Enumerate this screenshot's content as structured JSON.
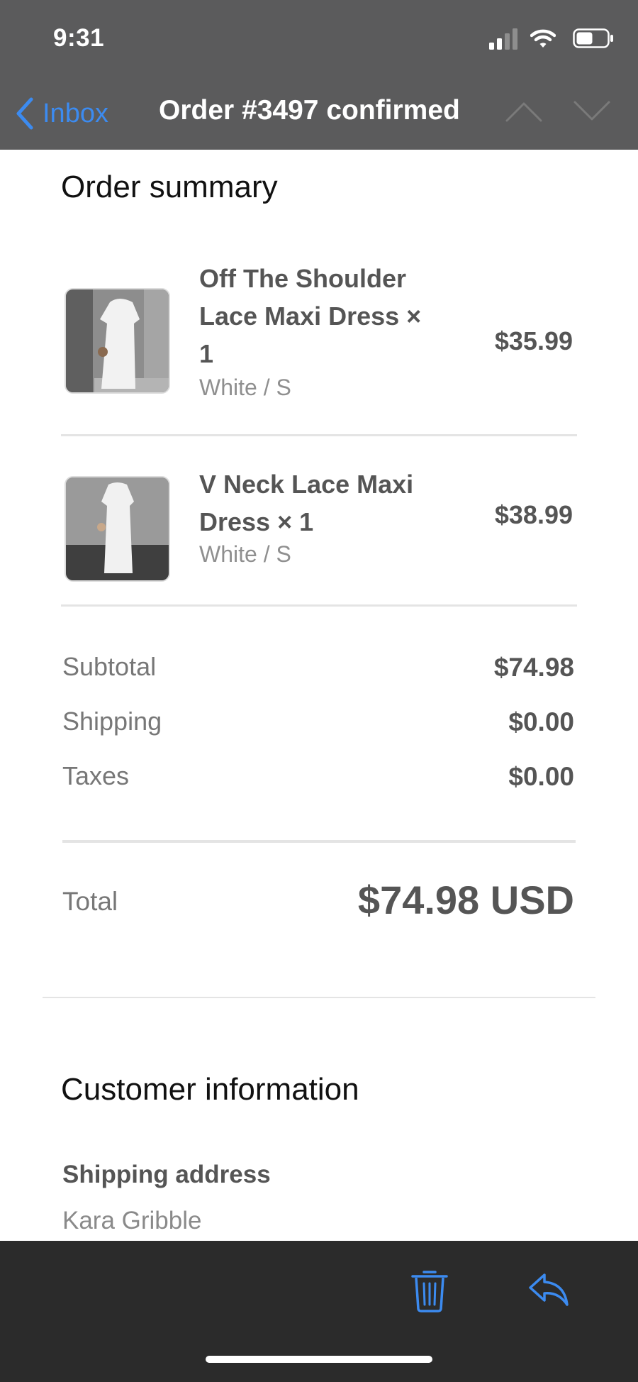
{
  "status_bar": {
    "time": "9:31"
  },
  "nav": {
    "back_label": "Inbox",
    "title": "Order #3497 confirmed"
  },
  "order_summary": {
    "heading": "Order summary",
    "items": [
      {
        "name": "Off The Shoulder Lace Maxi Dress × 1",
        "variant": "White / S",
        "price": "$35.99"
      },
      {
        "name": "V Neck Lace Maxi Dress × 1",
        "variant": "White / S",
        "price": "$38.99"
      }
    ],
    "costs": [
      {
        "label": "Subtotal",
        "value": "$74.98"
      },
      {
        "label": "Shipping",
        "value": "$0.00"
      },
      {
        "label": "Taxes",
        "value": "$0.00"
      }
    ],
    "total_label": "Total",
    "total_value": "$74.98 USD"
  },
  "customer_info": {
    "heading": "Customer information",
    "shipping_address_label": "Shipping address",
    "shipping_name": "Kara Gribble"
  },
  "toolbar": {
    "trash_icon": "trash-icon",
    "reply_icon": "reply-icon"
  },
  "colors": {
    "accent": "#3c8bf0",
    "header_bg": "#5b5b5c",
    "toolbar_bg": "#2b2b2b"
  }
}
